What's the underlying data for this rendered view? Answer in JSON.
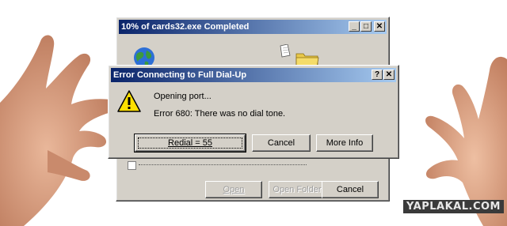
{
  "download_dialog": {
    "title": "10% of cards32.exe Completed",
    "open_label": "Open",
    "open_folder_label": "Open Folder",
    "cancel_label": "Cancel"
  },
  "error_dialog": {
    "title": "Error Connecting to Full Dial-Up",
    "help_glyph": "?",
    "close_glyph": "✕",
    "status": "Opening port...",
    "error_message": "Error 680: There was no dial tone.",
    "redial_label": "Redial = 55",
    "cancel_label": "Cancel",
    "more_info_label": "More Info"
  },
  "titlebar_glyphs": {
    "minimize": "_",
    "maximize": "□",
    "close": "✕"
  },
  "watermark": "YAPLAKAL.COM",
  "colors": {
    "title_active": "#0a246a",
    "title_fade": "#a6caf0",
    "face": "#d4d0c8"
  }
}
